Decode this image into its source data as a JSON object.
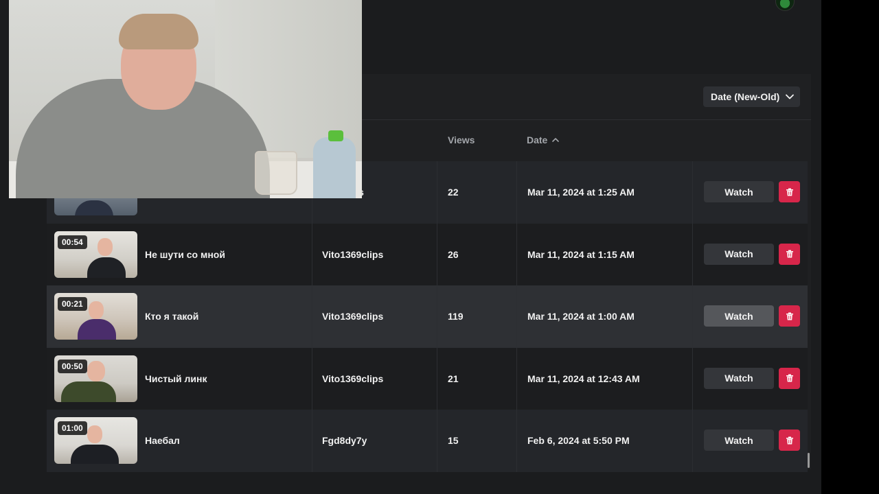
{
  "sort": {
    "label": "Date (New-Old)"
  },
  "columns": {
    "views": "Views",
    "date": "Date"
  },
  "rows": [
    {
      "duration": "",
      "title": "",
      "author": "clips",
      "views": "22",
      "date": "Mar 11, 2024 at 1:25 AM",
      "watch": "Watch"
    },
    {
      "duration": "00:54",
      "title": "Не шути со мной",
      "author": "Vito1369clips",
      "views": "26",
      "date": "Mar 11, 2024 at 1:15 AM",
      "watch": "Watch"
    },
    {
      "duration": "00:21",
      "title": "Кто я такой",
      "author": "Vito1369clips",
      "views": "119",
      "date": "Mar 11, 2024 at 1:00 AM",
      "watch": "Watch"
    },
    {
      "duration": "00:50",
      "title": "Чистый линк",
      "author": "Vito1369clips",
      "views": "21",
      "date": "Mar 11, 2024 at 12:43 AM",
      "watch": "Watch"
    },
    {
      "duration": "01:00",
      "title": "Наебал",
      "author": "Fgd8dy7y",
      "views": "15",
      "date": "Feb 6, 2024 at 5:50 PM",
      "watch": "Watch"
    }
  ],
  "colors": {
    "delete": "#d7264a",
    "background": "#1b1c1e",
    "panel": "#1f2022"
  },
  "icons": {
    "sort_chevron": "chevron-down-icon",
    "date_sort": "chevron-up-icon",
    "delete": "trash-icon"
  }
}
